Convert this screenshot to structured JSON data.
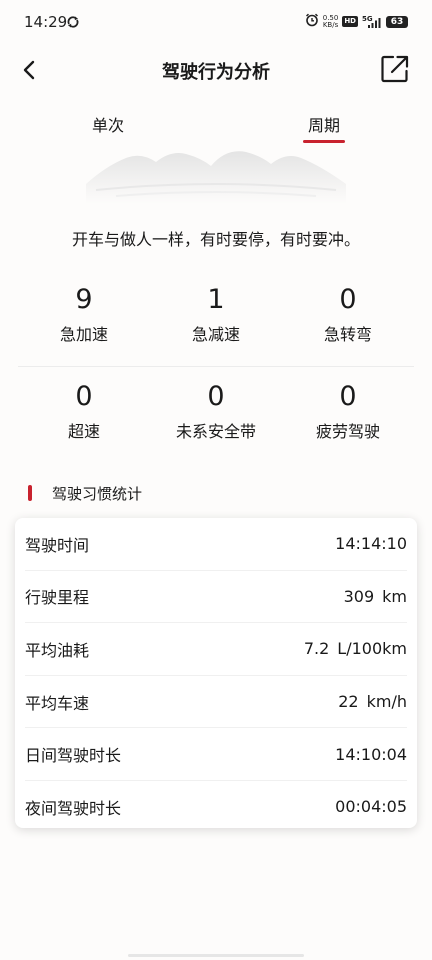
{
  "status_bar": {
    "time": "14:29",
    "net_speed_value": "0.50",
    "net_speed_unit": "KB/s",
    "hd_badge": "HD",
    "network": "5G",
    "battery": "63"
  },
  "header": {
    "title": "驾驶行为分析"
  },
  "tabs": [
    {
      "label": "单次"
    },
    {
      "label": "周期"
    }
  ],
  "slogan": "开车与做人一样，有时要停，有时要冲。",
  "stats": [
    {
      "value": "9",
      "label": "急加速"
    },
    {
      "value": "1",
      "label": "急减速"
    },
    {
      "value": "0",
      "label": "急转弯"
    },
    {
      "value": "0",
      "label": "超速"
    },
    {
      "value": "0",
      "label": "未系安全带"
    },
    {
      "value": "0",
      "label": "疲劳驾驶"
    }
  ],
  "section": {
    "title": "驾驶习惯统计"
  },
  "habits": [
    {
      "label": "驾驶时间",
      "value": "14:14:10",
      "unit": ""
    },
    {
      "label": "行驶里程",
      "value": "309",
      "unit": "km"
    },
    {
      "label": "平均油耗",
      "value": "7.2",
      "unit": "L/100km"
    },
    {
      "label": "平均车速",
      "value": "22",
      "unit": "km/h"
    },
    {
      "label": "日间驾驶时长",
      "value": "14:10:04",
      "unit": ""
    },
    {
      "label": "夜间驾驶时长",
      "value": "00:04:05",
      "unit": ""
    }
  ],
  "colors": {
    "accent": "#c8222e",
    "background": "#fdfcfb"
  }
}
